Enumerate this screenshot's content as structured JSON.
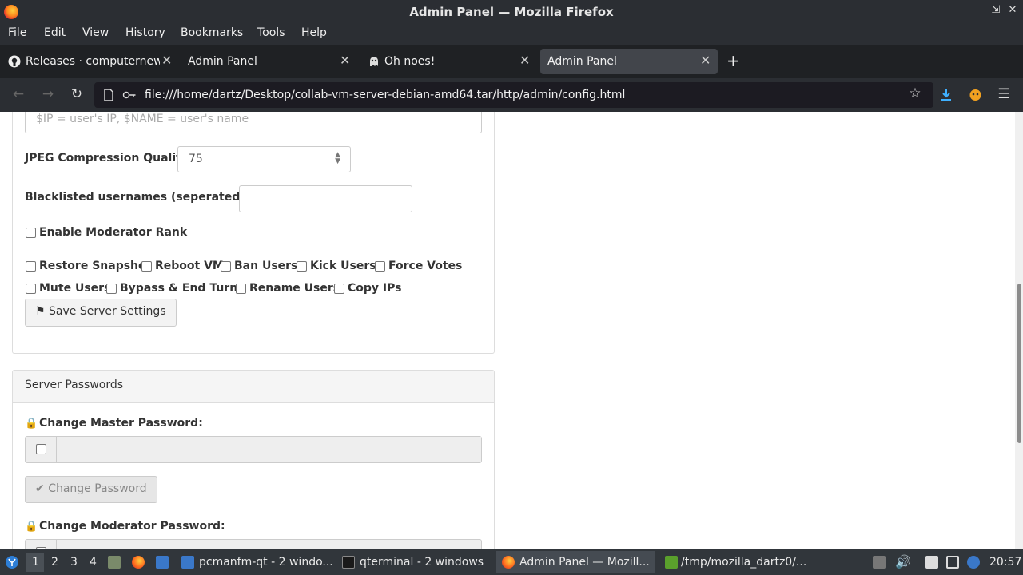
{
  "window": {
    "title": "Admin Panel — Mozilla Firefox"
  },
  "menu": [
    "File",
    "Edit",
    "View",
    "History",
    "Bookmarks",
    "Tools",
    "Help"
  ],
  "tabs": [
    {
      "label": "Releases · computernewb",
      "icon": "github-icon"
    },
    {
      "label": "Admin Panel",
      "icon": ""
    },
    {
      "label": "Oh noes!",
      "icon": "ghost-icon"
    },
    {
      "label": "Admin Panel",
      "icon": "",
      "active": true
    }
  ],
  "nav": {
    "url": "file:///home/dartz/Desktop/collab-vm-server-debian-amd64.tar/http/admin/config.html"
  },
  "settings": {
    "name_placeholder": "$IP = user's IP, $NAME = user's name",
    "jpeg_label": "JPEG Compression Quality:",
    "jpeg_value": "75",
    "blacklist_label": "Blacklisted usernames (seperated by ;):",
    "blacklist_value": "",
    "moderator_label": "Enable Moderator Rank",
    "perms_row1": [
      "Restore Snapshot",
      "Reboot VM",
      "Ban Users",
      "Kick Users",
      "Force Votes"
    ],
    "perms_row2": [
      "Mute Users",
      "Bypass & End Turns",
      "Rename Users",
      "Copy IPs"
    ],
    "save_label": "Save Server Settings"
  },
  "passwords": {
    "heading": "Server Passwords",
    "master_label": "Change Master Password:",
    "change_label": "Change Password",
    "moderator_label": "Change Moderator Password:"
  },
  "taskbar": {
    "workspaces": [
      "1",
      "2",
      "3",
      "4"
    ],
    "items": [
      "pcmanfm-qt - 2 windo...",
      "qterminal - 2 windows",
      "Admin Panel — Mozill...",
      "/tmp/mozilla_dartz0/..."
    ],
    "clock": "20:57"
  }
}
